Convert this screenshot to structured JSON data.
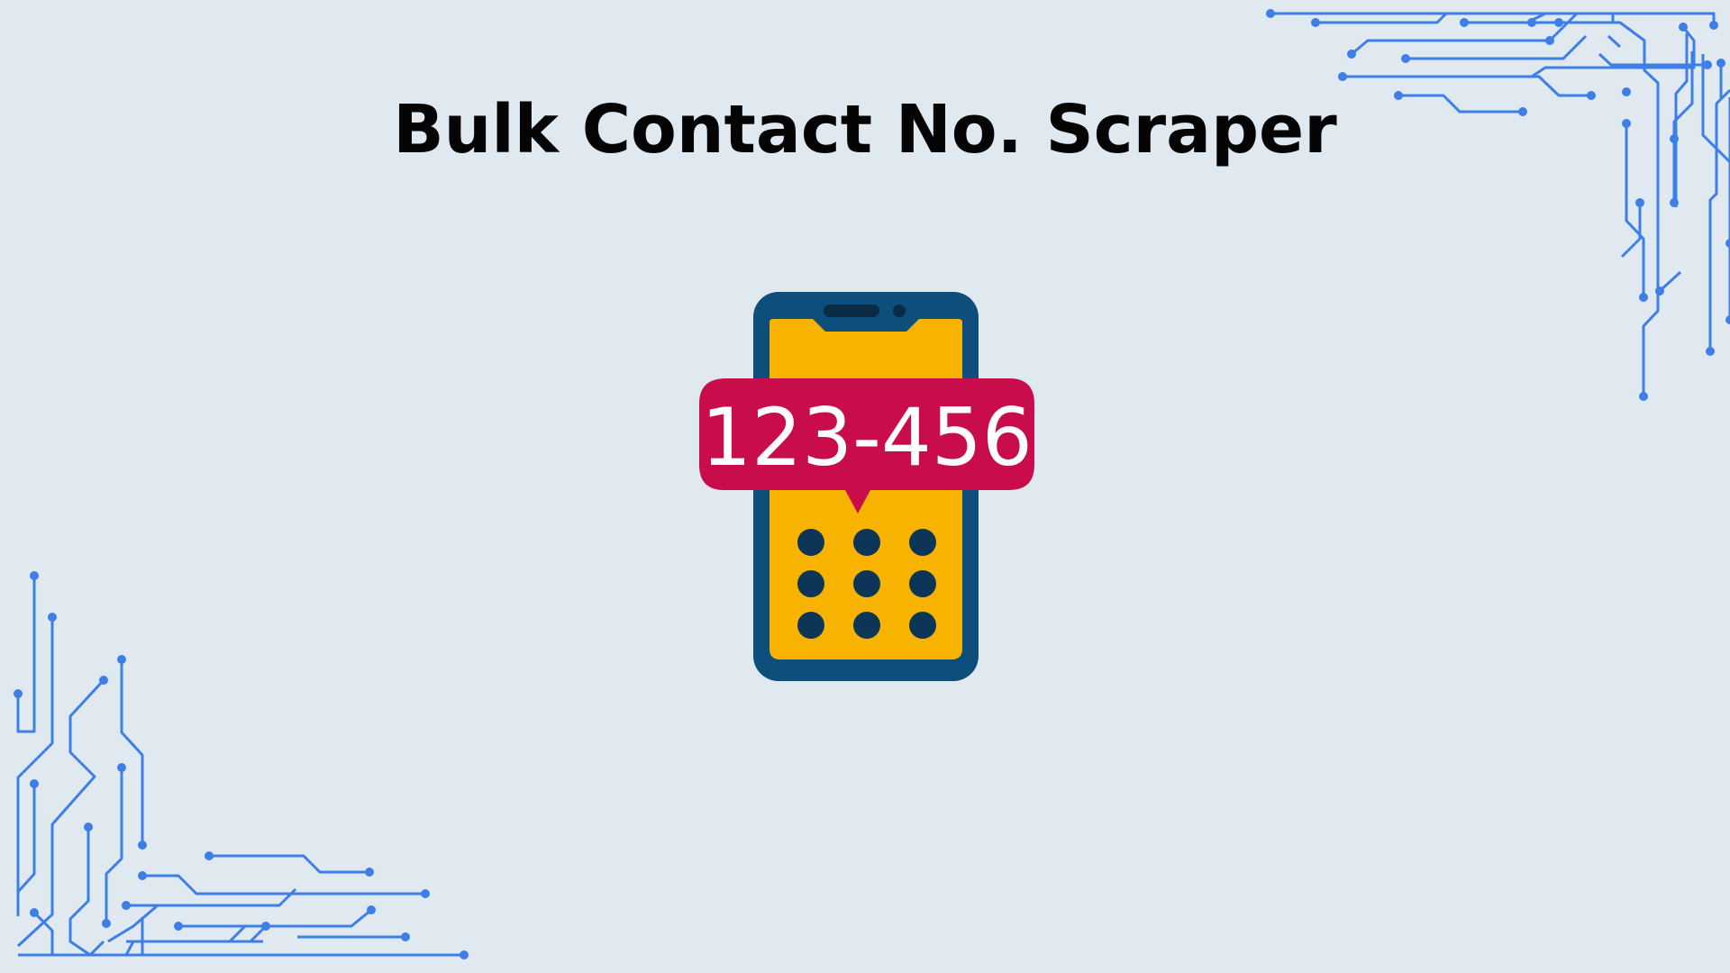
{
  "title": "Bulk Contact No. Scraper",
  "illustration": {
    "number_label": "123-456",
    "icon": "phone-contact-number-icon"
  },
  "colors": {
    "background": "#e0e8f0",
    "title": "#050505",
    "circuit": "#3d7fe6",
    "phone_body": "#0d4f7a",
    "phone_screen": "#f7b300",
    "bubble": "#c90c4a",
    "keypad_dot": "#0c3558"
  }
}
